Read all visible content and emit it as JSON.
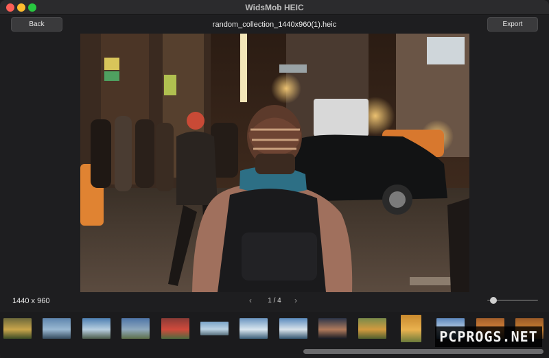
{
  "window": {
    "title": "WidsMob HEIC"
  },
  "toolbar": {
    "back_label": "Back",
    "filename": "random_collection_1440x960(1).heic",
    "export_label": "Export"
  },
  "viewer": {
    "dimensions": "1440 x 960",
    "page_indicator": "1 / 4",
    "zoom_slider_value": 0.07
  },
  "filmstrip": {
    "thumbnails": [
      {
        "name": "thumb-flowers",
        "colors": [
          "#6d6a3b",
          "#c9a54b",
          "#3a4a25"
        ]
      },
      {
        "name": "thumb-beach",
        "colors": [
          "#5f86ae",
          "#9ab8d2",
          "#344a5c"
        ]
      },
      {
        "name": "thumb-coast",
        "colors": [
          "#4e7fb2",
          "#b8cfe0",
          "#4b5b4a"
        ]
      },
      {
        "name": "thumb-cliff",
        "colors": [
          "#4f76a8",
          "#8fa9bd",
          "#5d6f49"
        ]
      },
      {
        "name": "thumb-red-flowers",
        "colors": [
          "#8a3b36",
          "#d04a3c",
          "#4d6b3e"
        ]
      },
      {
        "name": "thumb-bay",
        "colors": [
          "#7aa4c8",
          "#bcd3e4",
          "#566e7b"
        ]
      },
      {
        "name": "thumb-sea",
        "colors": [
          "#6b95c0",
          "#d9e6ef",
          "#3c5f78"
        ]
      },
      {
        "name": "thumb-harbor",
        "colors": [
          "#5b8bbe",
          "#d8e2ea",
          "#34556f"
        ]
      },
      {
        "name": "thumb-sunset",
        "colors": [
          "#2d3649",
          "#b07a5b",
          "#161a24"
        ]
      },
      {
        "name": "thumb-autumn",
        "colors": [
          "#7a8b4a",
          "#d29a3f",
          "#4f5e2e"
        ]
      },
      {
        "name": "thumb-tree",
        "colors": [
          "#c98a2e",
          "#e9b24f",
          "#6a7a3b"
        ]
      },
      {
        "name": "thumb-lake",
        "colors": [
          "#5d88bd",
          "#bcd2e8",
          "#2e4e72"
        ]
      },
      {
        "name": "thumb-orange-forest",
        "colors": [
          "#a35f2b",
          "#d6843a",
          "#51402a"
        ]
      },
      {
        "name": "thumb-autumn-2",
        "colors": [
          "#9a5a28",
          "#c98031",
          "#5b4229"
        ]
      }
    ]
  },
  "watermark": {
    "text": "PCPROGS.NET"
  }
}
